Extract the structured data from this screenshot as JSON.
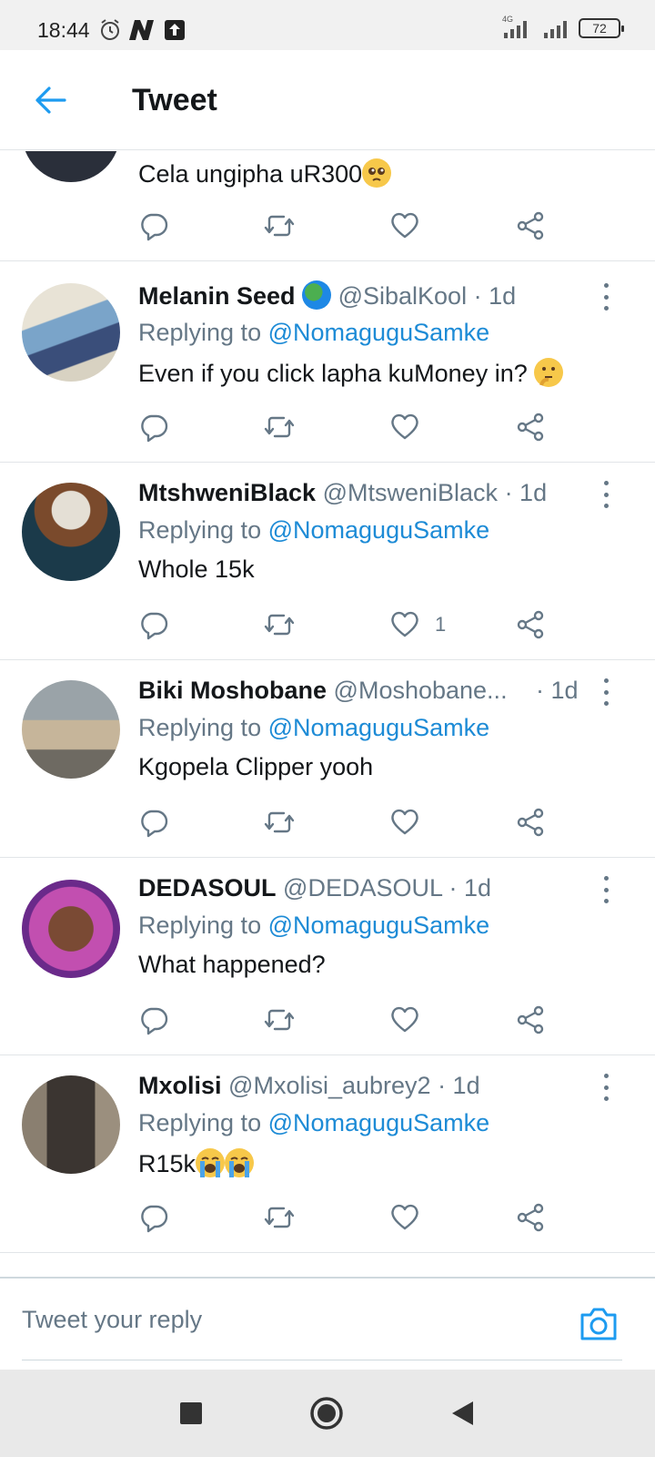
{
  "status_bar": {
    "time": "18:44",
    "network": "4G",
    "battery": "72",
    "icons": [
      "alarm-icon",
      "n-app-icon",
      "upload-icon",
      "signal-icon",
      "signal-icon",
      "battery-icon"
    ]
  },
  "header": {
    "title": "Tweet",
    "back_icon": "arrow-left-icon"
  },
  "tweets": [
    {
      "name": "",
      "handle": "",
      "time": "",
      "replying_label": "",
      "mention": "",
      "text": "Cela ungipha uR300",
      "text_emoji": "pleading-face",
      "like_count": ""
    },
    {
      "name": "Melanin Seed",
      "name_emoji": "globe-africa",
      "handle": "@SibalKool",
      "time": "· 1d",
      "replying_label": "Replying to",
      "mention": "@NomaguguSamke",
      "text": "Even if you click lapha kuMoney in?",
      "text_emoji": "thinking-face",
      "like_count": ""
    },
    {
      "name": "MtshweniBlack",
      "handle": "@MtsweniBlack",
      "time": "· 1d",
      "replying_label": "Replying to",
      "mention": "@NomaguguSamke",
      "text": "Whole 15k",
      "like_count": "1"
    },
    {
      "name": "Biki Moshobane",
      "handle": "@Moshobane...",
      "time": "· 1d",
      "replying_label": "Replying to",
      "mention": "@NomaguguSamke",
      "text": "Kgopela Clipper yooh",
      "like_count": ""
    },
    {
      "name": "DEDASOUL",
      "handle": "@DEDASOUL",
      "time": "· 1d",
      "replying_label": "Replying to",
      "mention": "@NomaguguSamke",
      "text": "What happened?",
      "like_count": ""
    },
    {
      "name": "Mxolisi",
      "handle": "@Mxolisi_aubrey2",
      "time": "· 1d",
      "replying_label": "Replying to",
      "mention": "@NomaguguSamke",
      "text": "R15k",
      "text_emoji": "loudly-crying-face x2",
      "like_count": ""
    }
  ],
  "actions": [
    "reply-icon",
    "retweet-icon",
    "like-icon",
    "share-icon"
  ],
  "composer": {
    "placeholder": "Tweet your reply",
    "camera_icon": "camera-icon"
  },
  "navbar": {
    "buttons": [
      "recents-square-icon",
      "home-circle-icon",
      "back-triangle-icon"
    ]
  },
  "colors": {
    "accent": "#1d9bf0",
    "mention": "#1d8bd6",
    "secondary_text": "#657786",
    "divider": "#e1e5e8"
  }
}
